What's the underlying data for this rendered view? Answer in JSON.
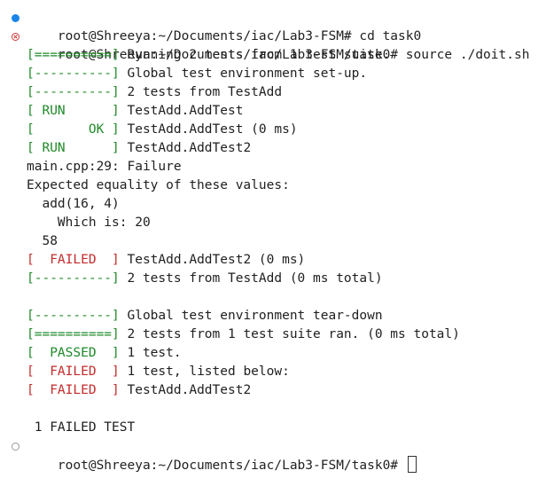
{
  "terminal": {
    "line1": {
      "prompt": "root@Shreeya:~/Documents/iac/Lab3-FSM#",
      "command": " cd task0"
    },
    "line2": {
      "prompt": "root@Shreeya:~/Documents/iac/Lab3-FSM/task0#",
      "command": " source ./doit.sh"
    },
    "line3": {
      "tag": "[==========]",
      "text": " Running 2 tests from 1 test suite."
    },
    "line4": {
      "tag": "[----------]",
      "text": " Global test environment set-up."
    },
    "line5": {
      "tag": "[----------]",
      "text": " 2 tests from TestAdd"
    },
    "line6": {
      "tag": "[ RUN      ]",
      "text": " TestAdd.AddTest"
    },
    "line7": {
      "tag": "[       OK ]",
      "text": " TestAdd.AddTest (0 ms)"
    },
    "line8": {
      "tag": "[ RUN      ]",
      "text": " TestAdd.AddTest2"
    },
    "line9": "main.cpp:29: Failure",
    "line10": "Expected equality of these values:",
    "line11": "  add(16, 4)",
    "line12": "    Which is: 20",
    "line13": "  58",
    "line14": {
      "tag": "[  FAILED  ]",
      "text": " TestAdd.AddTest2 (0 ms)"
    },
    "line15": {
      "tag": "[----------]",
      "text": " 2 tests from TestAdd (0 ms total)"
    },
    "line17": {
      "tag": "[----------]",
      "text": " Global test environment tear-down"
    },
    "line18": {
      "tag": "[==========]",
      "text": " 2 tests from 1 test suite ran. (0 ms total)"
    },
    "line19": {
      "tag": "[  PASSED  ]",
      "text": " 1 test."
    },
    "line20": {
      "tag": "[  FAILED  ]",
      "text": " 1 test, listed below:"
    },
    "line21": {
      "tag": "[  FAILED  ]",
      "text": " TestAdd.AddTest2"
    },
    "line23": " 1 FAILED TEST",
    "line24": {
      "prompt": "root@Shreeya:~/Documents/iac/Lab3-FSM/task0#",
      "command": " "
    }
  },
  "colors": {
    "pass_tag": "#1e8a28",
    "fail_tag": "#c42b2b",
    "decoration_success": "#1a85e6",
    "decoration_error": "#d03a3a"
  },
  "icons": {
    "success": "circle-filled-icon",
    "error": "circle-x-icon",
    "idle": "circle-outline-icon"
  }
}
